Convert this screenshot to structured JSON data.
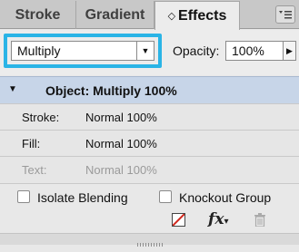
{
  "tabs": [
    {
      "label": "Stroke"
    },
    {
      "label": "Gradient"
    },
    {
      "label": "Effects",
      "active": true
    }
  ],
  "blend": {
    "mode": "Multiply",
    "opacity_label": "Opacity:",
    "opacity_value": "100%"
  },
  "object_row": {
    "label": "Object: Multiply 100%"
  },
  "sub_rows": [
    {
      "key": "Stroke:",
      "value": "Normal 100%"
    },
    {
      "key": "Fill:",
      "value": "Normal 100%"
    },
    {
      "key": "Text:",
      "value": "Normal 100%"
    }
  ],
  "checkboxes": {
    "isolate": "Isolate Blending",
    "knockout": "Knockout Group"
  },
  "icons": {
    "clear": "clear-effects-icon",
    "fx": "fx-icon",
    "trash": "trash-icon",
    "fx_glyph": "fx",
    "panel_menu": "panel-menu-icon"
  },
  "colors": {
    "focus_ring": "#2ab4e6",
    "object_row_bg": "#c7d5e8"
  }
}
